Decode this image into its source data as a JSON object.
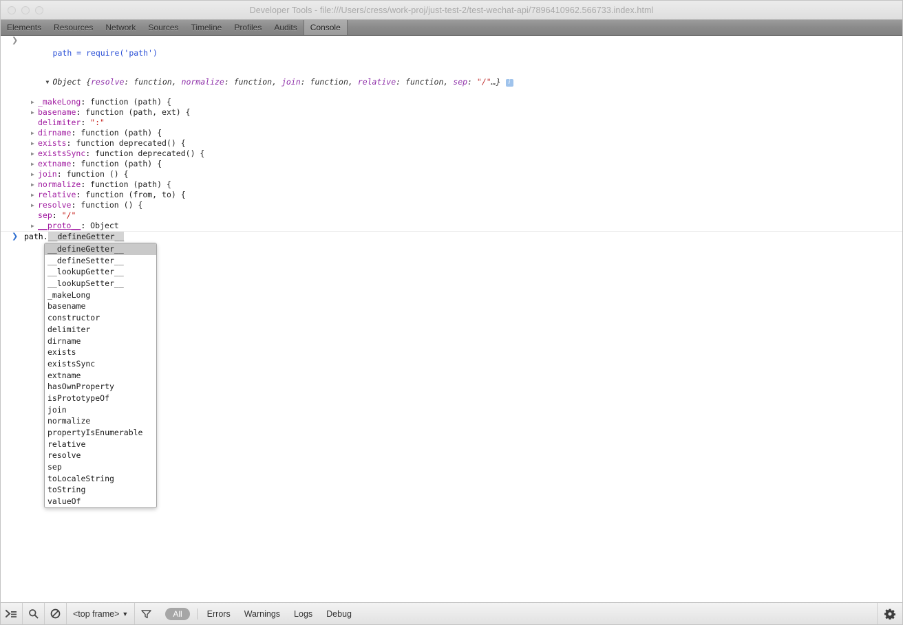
{
  "window": {
    "title": "Developer Tools - file:///Users/cress/work-proj/just-test-2/test-wechat-api/7896410962.566733.index.html",
    "traffic_lights": [
      "close",
      "minimize",
      "zoom"
    ]
  },
  "tabs": [
    {
      "label": "Elements",
      "selected": false
    },
    {
      "label": "Resources",
      "selected": false
    },
    {
      "label": "Network",
      "selected": false
    },
    {
      "label": "Sources",
      "selected": false
    },
    {
      "label": "Timeline",
      "selected": false
    },
    {
      "label": "Profiles",
      "selected": false
    },
    {
      "label": "Audits",
      "selected": false
    },
    {
      "label": "Console",
      "selected": true
    }
  ],
  "console": {
    "input_echo": "path = require('path')",
    "prompt_glyph": ">",
    "object_head": {
      "type": "Object",
      "brace_open": " {",
      "preview": [
        {
          "key": "resolve",
          "value": "function"
        },
        {
          "key": "normalize",
          "value": "function"
        },
        {
          "key": "join",
          "value": "function"
        },
        {
          "key": "relative",
          "value": "function"
        },
        {
          "key": "sep",
          "value": "\"/\""
        }
      ],
      "ellipsis": "…",
      "brace_close": "}",
      "info_badge": "i"
    },
    "properties": [
      {
        "expandable": true,
        "name": "_makeLong",
        "value": "function (path) {"
      },
      {
        "expandable": true,
        "name": "basename",
        "value": "function (path, ext) {"
      },
      {
        "expandable": false,
        "name": "delimiter",
        "value": "\":\"",
        "value_kind": "string"
      },
      {
        "expandable": true,
        "name": "dirname",
        "value": "function (path) {"
      },
      {
        "expandable": true,
        "name": "exists",
        "value": "function deprecated() {"
      },
      {
        "expandable": true,
        "name": "existsSync",
        "value": "function deprecated() {"
      },
      {
        "expandable": true,
        "name": "extname",
        "value": "function (path) {"
      },
      {
        "expandable": true,
        "name": "join",
        "value": "function () {"
      },
      {
        "expandable": true,
        "name": "normalize",
        "value": "function (path) {"
      },
      {
        "expandable": true,
        "name": "relative",
        "value": "function (from, to) {"
      },
      {
        "expandable": true,
        "name": "resolve",
        "value": "function () {"
      },
      {
        "expandable": false,
        "name": "sep",
        "value": "\"/\"",
        "value_kind": "string"
      },
      {
        "expandable": true,
        "name": "__proto__",
        "value": "Object",
        "value_kind": "object"
      }
    ],
    "prompt": {
      "typed": "path.",
      "completion": "__defineGetter__"
    }
  },
  "autocomplete": {
    "items": [
      {
        "label": "__defineGetter__",
        "selected": true
      },
      {
        "label": "__defineSetter__",
        "selected": false
      },
      {
        "label": "__lookupGetter__",
        "selected": false
      },
      {
        "label": "__lookupSetter__",
        "selected": false
      },
      {
        "label": "_makeLong",
        "selected": false
      },
      {
        "label": "basename",
        "selected": false
      },
      {
        "label": "constructor",
        "selected": false
      },
      {
        "label": "delimiter",
        "selected": false
      },
      {
        "label": "dirname",
        "selected": false
      },
      {
        "label": "exists",
        "selected": false
      },
      {
        "label": "existsSync",
        "selected": false
      },
      {
        "label": "extname",
        "selected": false
      },
      {
        "label": "hasOwnProperty",
        "selected": false
      },
      {
        "label": "isPrototypeOf",
        "selected": false
      },
      {
        "label": "join",
        "selected": false
      },
      {
        "label": "normalize",
        "selected": false
      },
      {
        "label": "propertyIsEnumerable",
        "selected": false
      },
      {
        "label": "relative",
        "selected": false
      },
      {
        "label": "resolve",
        "selected": false
      },
      {
        "label": "sep",
        "selected": false
      },
      {
        "label": "toLocaleString",
        "selected": false
      },
      {
        "label": "toString",
        "selected": false
      },
      {
        "label": "valueOf",
        "selected": false
      }
    ]
  },
  "statusbar": {
    "buttons": [
      {
        "icon": "console-prompt-icon"
      },
      {
        "icon": "search-icon"
      },
      {
        "icon": "clear-console-icon"
      }
    ],
    "frame_selector": {
      "label": "<top frame>",
      "caret": "▼"
    },
    "filter_icon": "filter-funnel-icon",
    "filters": [
      {
        "label": "All",
        "active": true
      },
      {
        "label": "Errors",
        "active": false
      },
      {
        "label": "Warnings",
        "active": false
      },
      {
        "label": "Logs",
        "active": false
      },
      {
        "label": "Debug",
        "active": false
      }
    ],
    "settings_icon": "gear-icon"
  },
  "colors": {
    "property_name": "#a01aa0",
    "string_value": "#c41a16",
    "input_echo": "#2a4fd6",
    "info_badge_bg": "#9fc3ec",
    "selection": "#c9c9c9"
  }
}
